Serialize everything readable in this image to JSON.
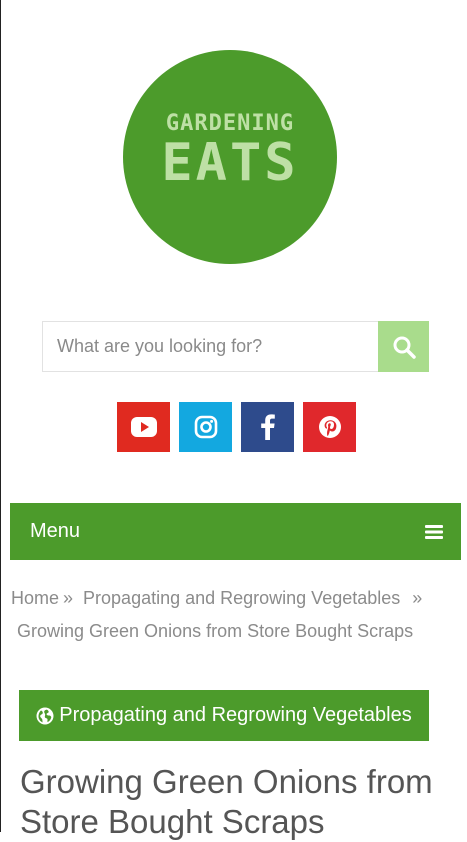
{
  "logo": {
    "line1": "GARDENING",
    "line2": "EATS",
    "color": "#4c9b2b"
  },
  "search": {
    "placeholder": "What are you looking for?",
    "button_icon": "search-icon",
    "button_color": "#a9dc8c"
  },
  "social": [
    {
      "name": "youtube",
      "icon": "youtube-icon",
      "color": "#e02a20"
    },
    {
      "name": "instagram",
      "icon": "instagram-icon",
      "color": "#13a8e0"
    },
    {
      "name": "facebook",
      "icon": "facebook-icon",
      "color": "#2e4b8c"
    },
    {
      "name": "pinterest",
      "icon": "pinterest-icon",
      "color": "#e0282c"
    }
  ],
  "nav": {
    "label": "Menu",
    "icon": "hamburger-icon"
  },
  "breadcrumb": {
    "home": "Home",
    "separator": "»",
    "category": "Propagating and Regrowing Vegetables",
    "current": "Growing Green Onions from Store Bought Scraps"
  },
  "category_button": {
    "icon": "globe-icon",
    "label": "Propagating and Regrowing Vegetables"
  },
  "article": {
    "title": "Growing Green Onions from Store Bought Scraps"
  },
  "colors": {
    "brand_green": "#4c9b2b",
    "text_gray": "#8b8b8b"
  }
}
